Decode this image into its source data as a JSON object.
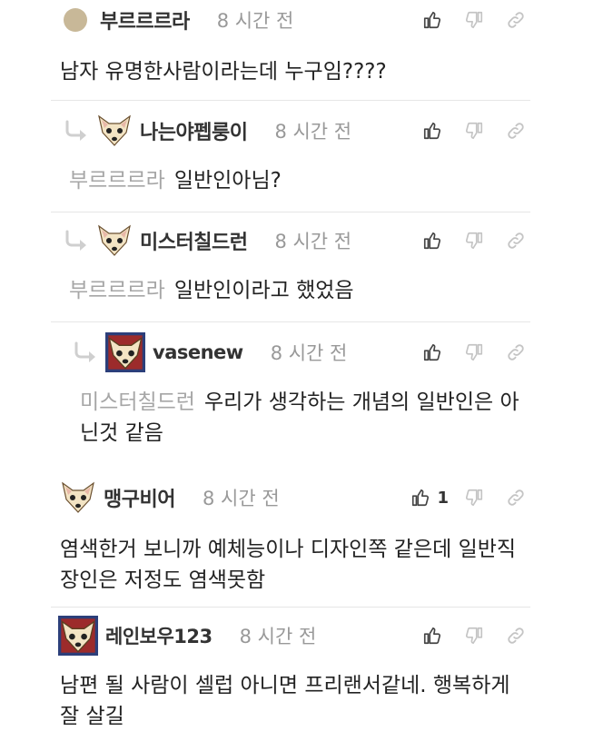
{
  "comments": [
    {
      "nickname": "부르르르라",
      "time": "8 시간 전",
      "text": "남자 유명한사람이라는데 누구임????",
      "mention": "",
      "avatar": "round-avatar-icon",
      "like_count": ""
    },
    {
      "nickname": "나는야펩룽이",
      "time": "8 시간 전",
      "text": "일반인아님?",
      "mention": "부르르르라",
      "avatar": "dog-avatar-icon",
      "like_count": ""
    },
    {
      "nickname": "미스터칠드런",
      "time": "8 시간 전",
      "text": "일반인이라고 했었음",
      "mention": "부르르르라",
      "avatar": "dog-avatar-icon",
      "like_count": ""
    },
    {
      "nickname": "vasenew",
      "time": "8 시간 전",
      "text": "우리가 생각하는 개념의 일반인은 아닌것 같음",
      "mention": "미스터칠드런",
      "avatar": "dog-avatar-pattern-icon",
      "like_count": ""
    },
    {
      "nickname": "맹구비어",
      "time": "8 시간 전",
      "text": "염색한거 보니까 예체능이나 디자인쪽 같은데 일반직장인은 저정도 염색못함",
      "mention": "",
      "avatar": "dog-avatar-icon",
      "like_count": "1"
    },
    {
      "nickname": "레인보우123",
      "time": "8 시간 전",
      "text": "남편 될 사람이 셀럽 아니면 프리랜서같네. 행복하게 잘 살길",
      "mention": "",
      "avatar": "dog-avatar-pattern-icon",
      "like_count": ""
    }
  ],
  "icons": {
    "like": "thumbs-up-icon",
    "dislike": "thumbs-down-icon",
    "link": "link-icon",
    "reply": "reply-arrow-icon"
  },
  "colors": {
    "nickname": "#333333",
    "time": "#999999",
    "mention": "#a6a6a6",
    "text": "#222222",
    "divider": "#e6e6e6"
  }
}
